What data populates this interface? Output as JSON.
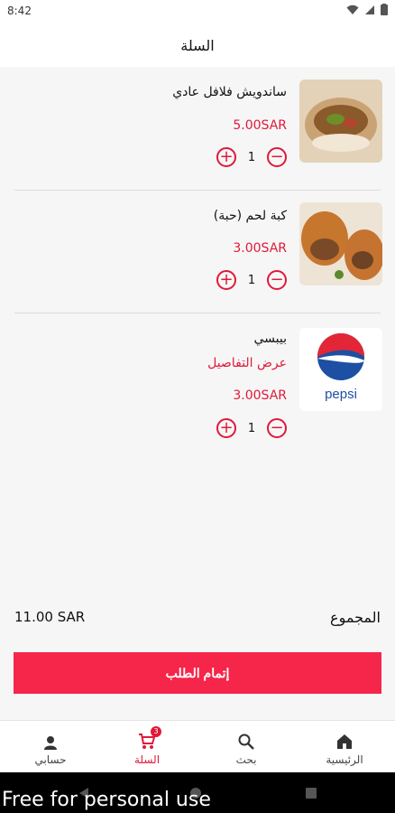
{
  "status_bar": {
    "time": "8:42"
  },
  "app_bar": {
    "title": "السلة"
  },
  "cart_items": [
    {
      "name": "ساندويش فلافل عادي",
      "price": "5.00SAR",
      "quantity": "1",
      "details_link": ""
    },
    {
      "name": "كبة لحم (حبة)",
      "price": "3.00SAR",
      "quantity": "1",
      "details_link": ""
    },
    {
      "name": "بيبسي",
      "price": "3.00SAR",
      "quantity": "1",
      "details_link": "عرض التفاصيل",
      "logo_text": "pepsi"
    }
  ],
  "total": {
    "label": "المجموع",
    "value": "11.00 SAR"
  },
  "checkout": {
    "label": "إتمام الطلب"
  },
  "bottom_nav": {
    "account": "حسابي",
    "cart": "السلة",
    "cart_badge": "3",
    "search": "بحث",
    "home": "الرئيسية"
  },
  "watermark": "Free for personal use",
  "colors": {
    "accent": "#e0193a",
    "button": "#f5264a"
  }
}
